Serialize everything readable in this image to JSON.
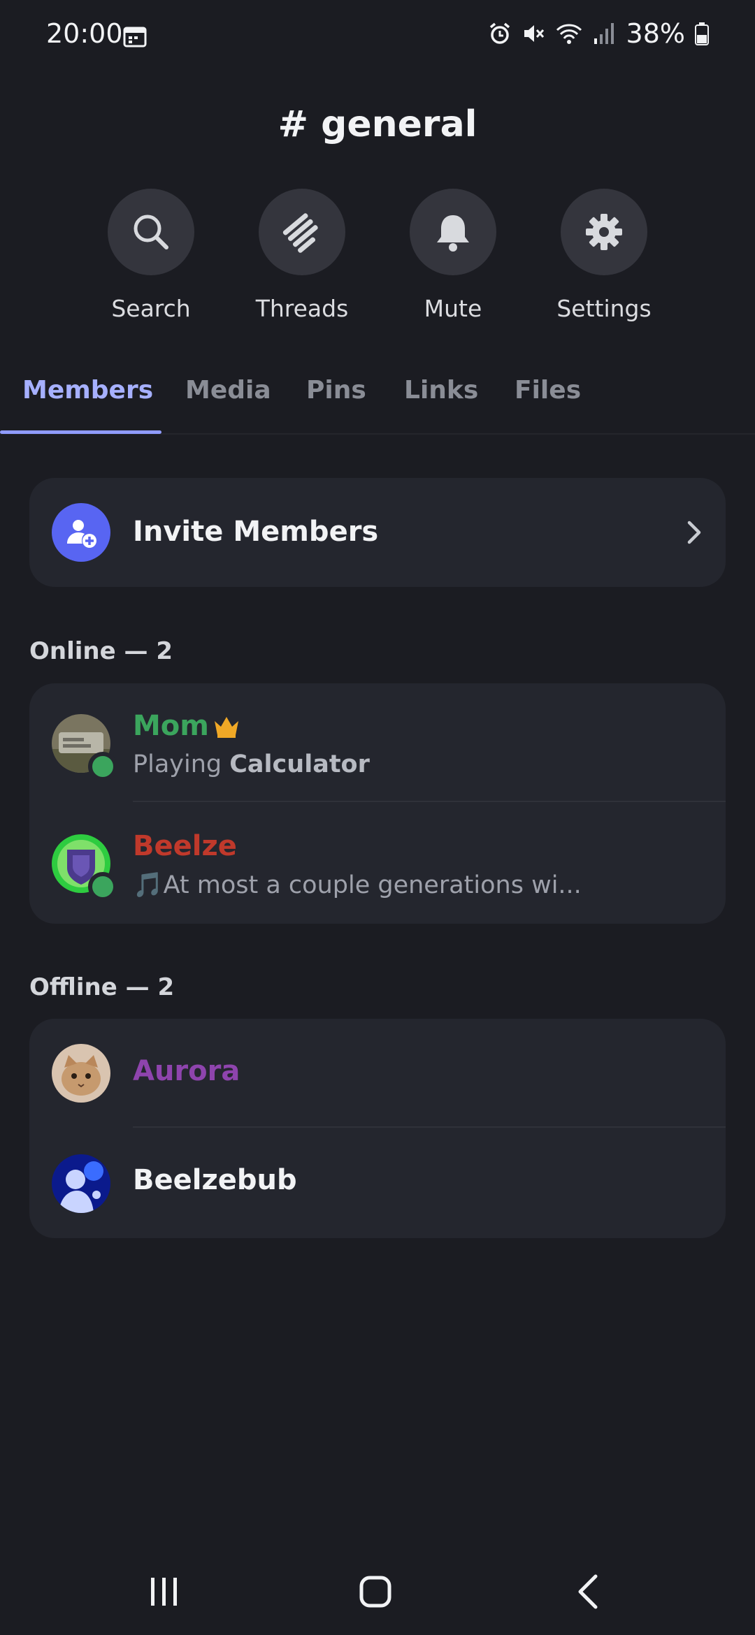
{
  "status_bar": {
    "time": "20:00",
    "battery": "38%",
    "icons": [
      "calendar-icon",
      "alarm-icon",
      "mute-icon",
      "wifi-icon",
      "signal-icon",
      "battery-icon"
    ]
  },
  "channel": {
    "title": "# general"
  },
  "actions": [
    {
      "label": "Search",
      "icon": "search-icon"
    },
    {
      "label": "Threads",
      "icon": "threads-icon"
    },
    {
      "label": "Mute",
      "icon": "bell-icon"
    },
    {
      "label": "Settings",
      "icon": "gear-icon"
    }
  ],
  "tabs": [
    {
      "label": "Members",
      "active": true
    },
    {
      "label": "Media"
    },
    {
      "label": "Pins"
    },
    {
      "label": "Links"
    },
    {
      "label": "Files"
    }
  ],
  "invite": {
    "label": "Invite Members"
  },
  "online": {
    "header": "Online — 2",
    "members": [
      {
        "name": "Mom",
        "name_color": "#3ba55d",
        "activity_prefix": "Playing ",
        "activity_bold": "Calculator",
        "owner_badge": "crown-icon"
      },
      {
        "name": "Beelze",
        "name_color": "#c0392b",
        "status_emoji": "🎵",
        "status_text": "At most a couple generations wi..."
      }
    ]
  },
  "offline": {
    "header": "Offline — 2",
    "members": [
      {
        "name": "Aurora",
        "name_color": "#8e44ad"
      },
      {
        "name": "Beelzebub",
        "name_color": "#f2f3f5"
      }
    ]
  },
  "colors": {
    "accent": "#a6b0ff",
    "background": "#1b1c22",
    "card": "#24262e",
    "online": "#3ba55d"
  }
}
